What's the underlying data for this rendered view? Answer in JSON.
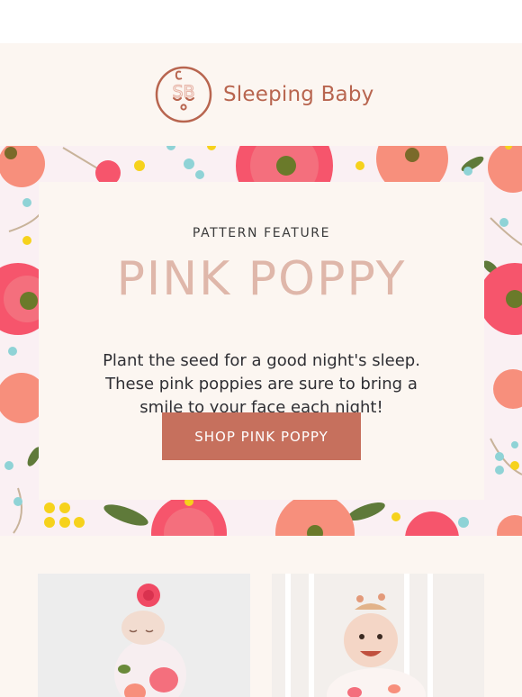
{
  "brand": {
    "name": "Sleeping Baby",
    "logo_icon": "sleeping-baby-face-icon",
    "logo_initials": "SB"
  },
  "hero": {
    "eyebrow": "PATTERN FEATURE",
    "headline": "PINK POPPY",
    "body": "Plant the seed for a good night's sleep. These pink poppies are sure to bring a smile to your face each night!",
    "cta_label": "SHOP PINK POPPY"
  },
  "colors": {
    "page_background": "#fcf6f1",
    "brand_accent": "#b8654f",
    "headline_color": "#dfb7aa",
    "cta_background": "#c6705d",
    "pattern_background": "#faf0f3",
    "poppy_pink": "#f6556c",
    "poppy_coral": "#f78f7c"
  },
  "products": [
    {
      "photo": "newborn-in-pink-poppy-swaddle"
    },
    {
      "photo": "smiling-toddler-in-pink-poppy-sleepsuit"
    }
  ]
}
